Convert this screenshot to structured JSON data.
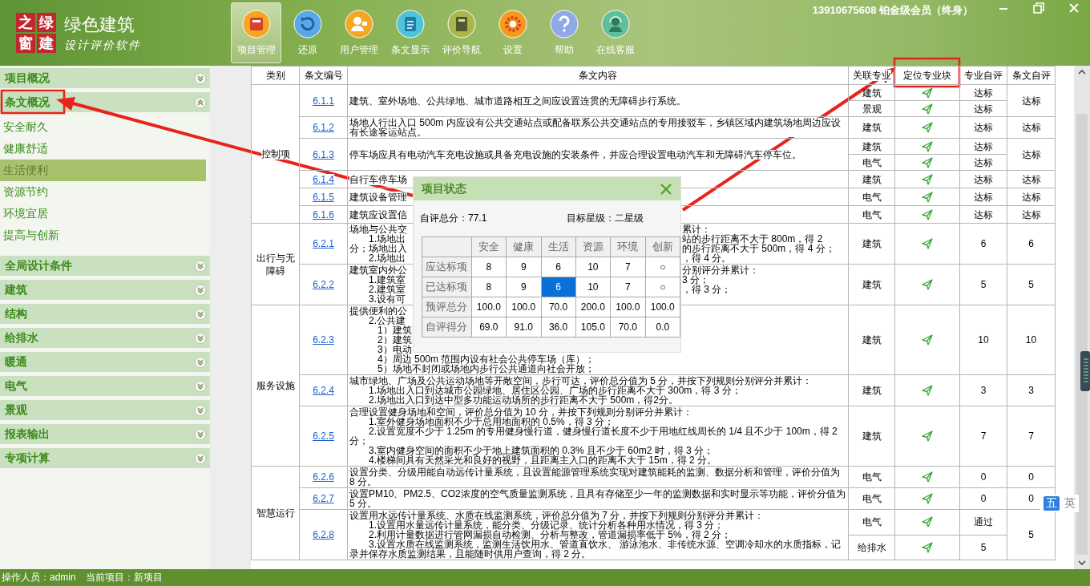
{
  "app": {
    "logo": [
      "之",
      "绿",
      "窗",
      "建"
    ],
    "title": "绿色建筑",
    "subtitle": "设计评价软件"
  },
  "toolbar": [
    {
      "label": "项目管理",
      "selected": true
    },
    {
      "label": "还原",
      "selected": false
    },
    {
      "label": "用户管理",
      "selected": false
    },
    {
      "label": "条文显示",
      "selected": false
    },
    {
      "label": "评价导航",
      "selected": false
    },
    {
      "label": "设置",
      "selected": false
    },
    {
      "label": "帮助",
      "selected": false
    },
    {
      "label": "在线客服",
      "selected": false
    }
  ],
  "account": "13910675608 铂金级会员（终身）",
  "sidebar": [
    {
      "label": "项目概况",
      "expanded": false
    },
    {
      "label": "条文概况",
      "expanded": true,
      "children": [
        {
          "label": "安全耐久",
          "selected": false
        },
        {
          "label": "健康舒适",
          "selected": false
        },
        {
          "label": "生活便利",
          "selected": true
        },
        {
          "label": "资源节约",
          "selected": false
        },
        {
          "label": "环境宜居",
          "selected": false
        },
        {
          "label": "提高与创新",
          "selected": false
        }
      ]
    },
    {
      "label": "全局设计条件",
      "expanded": false
    },
    {
      "label": "建筑",
      "expanded": false
    },
    {
      "label": "结构",
      "expanded": false
    },
    {
      "label": "给排水",
      "expanded": false
    },
    {
      "label": "暖通",
      "expanded": false
    },
    {
      "label": "电气",
      "expanded": false
    },
    {
      "label": "景观",
      "expanded": false
    },
    {
      "label": "报表输出",
      "expanded": false
    },
    {
      "label": "专项计算",
      "expanded": false
    }
  ],
  "table": {
    "columns": [
      "类别",
      "条文编号",
      "条文内容",
      "关联专业",
      "定位专业块",
      "专业自评",
      "条文自评"
    ],
    "groups": [
      {
        "category": "控制项",
        "rows": [
          {
            "number": "6.1.1",
            "lines": [
              {
                "kind": "lead",
                "text": "建筑、室外场地、公共绿地、城市道路相互之间应设置连贯的无障碍步行系统。"
              }
            ],
            "items": [
              {
                "discipline": "建筑",
                "self_eval": "达标"
              },
              {
                "discipline": "景观",
                "self_eval": "达标"
              }
            ],
            "clause_eval": "达标"
          },
          {
            "number": "6.1.2",
            "lines": [
              {
                "kind": "lead",
                "text": "场地人行出入口 500m 内应设有公共交通站点或配备联系公共交通站点的专用接驳车，乡镇区域内建筑场地周边应设有长途客运站点。"
              }
            ],
            "items": [
              {
                "discipline": "建筑",
                "self_eval": "达标"
              }
            ],
            "clause_eval": "达标"
          },
          {
            "number": "6.1.3",
            "lines": [
              {
                "kind": "lead",
                "text": "停车场应具有电动汽车充电设施或具备充电设施的安装条件，并应合理设置电动汽车和无障碍汽车停车位。"
              }
            ],
            "items": [
              {
                "discipline": "建筑",
                "self_eval": "达标"
              },
              {
                "discipline": "电气",
                "self_eval": "达标"
              }
            ],
            "clause_eval": "达标"
          },
          {
            "number": "6.1.4",
            "lines": [
              {
                "kind": "lead",
                "left": "自行车停车场"
              }
            ],
            "items": [
              {
                "discipline": "建筑",
                "self_eval": "达标"
              }
            ],
            "clause_eval": "达标"
          },
          {
            "number": "6.1.5",
            "lines": [
              {
                "kind": "lead",
                "left": "建筑设备管理"
              }
            ],
            "items": [
              {
                "discipline": "电气",
                "self_eval": "达标"
              }
            ],
            "clause_eval": "达标"
          },
          {
            "number": "6.1.6",
            "lines": [
              {
                "kind": "lead",
                "left": "建筑应设置信"
              }
            ],
            "items": [
              {
                "discipline": "电气",
                "self_eval": "达标"
              }
            ],
            "clause_eval": "达标"
          }
        ]
      },
      {
        "category": "出行与无障碍",
        "rows": [
          {
            "number": "6.2.1",
            "lines": [
              {
                "kind": "lead",
                "left": "场地与公共交",
                "right": "累计："
              },
              {
                "kind": "item",
                "left": "1.场地出",
                "right": "站的步行距离不大于 800m，得 2"
              },
              {
                "kind": "lead",
                "left": "分；场地出入",
                "right": "的步行距离不大于 500m，得 4 分；"
              },
              {
                "kind": "item",
                "left": "2.场地出",
                "right": "，得 4 分。"
              }
            ],
            "items": [
              {
                "discipline": "建筑",
                "self_eval": "6"
              }
            ],
            "clause_eval": "6"
          },
          {
            "number": "6.2.2",
            "lines": [
              {
                "kind": "lead",
                "left": "建筑室内外公",
                "right": "分别评分并累计："
              },
              {
                "kind": "item",
                "left": "1.建筑室",
                "right": "3 分；"
              },
              {
                "kind": "item",
                "left": "2.建筑室",
                "right": "，得 3 分；"
              },
              {
                "kind": "item",
                "left": "3.设有可"
              }
            ],
            "items": [
              {
                "discipline": "建筑",
                "self_eval": "5"
              }
            ],
            "clause_eval": "5"
          }
        ]
      },
      {
        "category": "服务设施",
        "rows": [
          {
            "number": "6.2.3",
            "lines": [
              {
                "kind": "lead",
                "left": "提供便利的公"
              },
              {
                "kind": "item",
                "left": "2.公共建"
              },
              {
                "kind": "sub",
                "left": "1）建筑"
              },
              {
                "kind": "sub",
                "left": "2）建筑"
              },
              {
                "kind": "sub",
                "left": "3）电动"
              },
              {
                "kind": "sub",
                "text": "4）周边 500m 范围内设有社会公共停车场（库）；"
              },
              {
                "kind": "sub",
                "text": "5）场地不封闭或场地内步行公共通道向社会开放；"
              }
            ],
            "items": [
              {
                "discipline": "建筑",
                "self_eval": "10"
              }
            ],
            "clause_eval": "10"
          },
          {
            "number": "6.2.4",
            "lines": [
              {
                "kind": "lead",
                "text": "城市绿地、广场及公共运动场地等开敞空间，步行可达，评价总分值为 5 分，并按下列规则分别评分并累计："
              },
              {
                "kind": "item",
                "text": "1.场地出入口到达城市公园绿地、居住区公园、广场的步行距离不大于 300m，得 3 分；"
              },
              {
                "kind": "item",
                "text": "2.场地出入口到达中型多功能运动场所的步行距离不大于 500m，得2分。"
              }
            ],
            "items": [
              {
                "discipline": "建筑",
                "self_eval": "3"
              }
            ],
            "clause_eval": "3"
          },
          {
            "number": "6.2.5",
            "lines": [
              {
                "kind": "lead",
                "text": "合理设置健身场地和空间，评价总分值为 10 分，并按下列规则分别评分并累计："
              },
              {
                "kind": "item",
                "text": "1.室外健身场地面积不少于总用地面积的 0.5%，得 3 分；"
              },
              {
                "kind": "item",
                "text": "2.设置宽度不少于 1.25m 的专用健身慢行道，健身慢行道长度不少于用地红线周长的 1/4 且不少于 100m，得 2 分；"
              },
              {
                "kind": "item",
                "text": "3.室内健身空间的面积不少于地上建筑面积的 0.3% 且不少于 60m2 时，得 3 分；"
              },
              {
                "kind": "item",
                "text": "4.楼梯间具有天然采光和良好的视野，且距离主入口的距离不大于 15m，得 2 分。"
              }
            ],
            "items": [
              {
                "discipline": "建筑",
                "self_eval": "7"
              }
            ],
            "clause_eval": "7"
          }
        ]
      },
      {
        "category": "智慧运行",
        "rows": [
          {
            "number": "6.2.6",
            "lines": [
              {
                "kind": "lead",
                "text": "设置分类、分级用能自动远传计量系统，且设置能源管理系统实现对建筑能耗的监测、数据分析和管理，评价分值为 8 分。"
              }
            ],
            "items": [
              {
                "discipline": "电气",
                "self_eval": "0"
              }
            ],
            "clause_eval": "0"
          },
          {
            "number": "6.2.7",
            "lines": [
              {
                "kind": "lead",
                "text": "设置PM10、PM2.5、CO2浓度的空气质量监测系统，且具有存储至少一年的监测数据和实时显示等功能，评价分值为 5 分。"
              }
            ],
            "items": [
              {
                "discipline": "电气",
                "self_eval": "0"
              }
            ],
            "clause_eval": "0"
          },
          {
            "number": "6.2.8",
            "lines": [
              {
                "kind": "lead",
                "text": "设置用水远传计量系统、水质在线监测系统，评价总分值为 7 分，并按下列规则分别评分并累计："
              },
              {
                "kind": "item",
                "text": "1.设置用水量远传计量系统，能分类、分级记录、统计分析各种用水情况，得 3 分；"
              },
              {
                "kind": "item",
                "text": "2.利用计量数据进行管网漏损自动检测、分析与整改，管道漏损率低于 5%，得 2 分；"
              },
              {
                "kind": "item",
                "text": "3.设置水质在线监测系统，监测生活饮用水、管道直饮水、 游泳池水、非传统水源、空调冷却水的水质指标，记录并保存水质监测结果，且能随时供用户查询，得 2 分。"
              }
            ],
            "items": [
              {
                "discipline": "电气",
                "self_eval": "通过"
              },
              {
                "discipline": "给排水",
                "self_eval": "5"
              }
            ],
            "clause_eval": "5"
          }
        ]
      }
    ]
  },
  "status_dialog": {
    "title": "项目状态",
    "total": "自评总分：77.1",
    "star": "目标星级：二星级",
    "columns": [
      "安全",
      "健康",
      "生活",
      "资源",
      "环境",
      "创新"
    ],
    "rows": [
      {
        "label": "应达标项",
        "cells": [
          {
            "text": "8",
            "selected": false
          },
          {
            "text": "9",
            "selected": false
          },
          {
            "text": "6",
            "selected": false
          },
          {
            "text": "10",
            "selected": false
          },
          {
            "text": "7",
            "selected": false
          },
          {
            "text": "○",
            "selected": false
          }
        ]
      },
      {
        "label": "已达标项",
        "cells": [
          {
            "text": "8",
            "selected": false
          },
          {
            "text": "9",
            "selected": false
          },
          {
            "text": "6",
            "selected": true
          },
          {
            "text": "10",
            "selected": false
          },
          {
            "text": "7",
            "selected": false
          },
          {
            "text": "○",
            "selected": false
          }
        ]
      },
      {
        "label": "预评总分",
        "cells": [
          {
            "text": "100.0",
            "selected": false
          },
          {
            "text": "100.0",
            "selected": false
          },
          {
            "text": "70.0",
            "selected": false
          },
          {
            "text": "200.0",
            "selected": false
          },
          {
            "text": "100.0",
            "selected": false
          },
          {
            "text": "100.0",
            "selected": false
          }
        ]
      },
      {
        "label": "自评得分",
        "cells": [
          {
            "text": "69.0",
            "selected": false
          },
          {
            "text": "91.0",
            "selected": false
          },
          {
            "text": "36.0",
            "selected": false
          },
          {
            "text": "105.0",
            "selected": false
          },
          {
            "text": "70.0",
            "selected": false
          },
          {
            "text": "0.0",
            "selected": false
          }
        ]
      }
    ]
  },
  "ime": {
    "mode": "五",
    "lang": "英"
  },
  "status_bar": [
    "操作人员：admin",
    "当前项目：新项目"
  ]
}
